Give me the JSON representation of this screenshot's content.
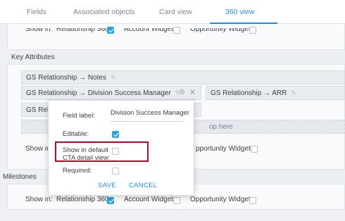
{
  "tabs": [
    {
      "label": "Fields"
    },
    {
      "label": "Associated objects"
    },
    {
      "label": "Card view"
    },
    {
      "label": "360 view",
      "active": true
    }
  ],
  "top_row": {
    "show_in": "Show in:",
    "relationship_label": "Relationship 360",
    "account_widget": "Account Widget",
    "opportunity_widget": "Opportunity Widget"
  },
  "key_attributes": {
    "title": "Key Attributes",
    "chips": {
      "notes": "GS Relationship → Notes",
      "dsm": "GS Relationship → Division Success Manager",
      "arr": "GS Relationship → ARR",
      "partial": "GS Relatio"
    },
    "drop_text": "op here",
    "show_in": "Show in:",
    "opportunity_widget": "pportunity Widget"
  },
  "milestones": {
    "title": "Milestones",
    "show_in": "Show in:",
    "relationship_label": "Relationship 360",
    "account_widget": "Account Widget",
    "opportunity_widget": "Opportunity Widget"
  },
  "popup": {
    "field_label_label": "Field label:",
    "field_label_value": "Division Success Manager",
    "editable_label": "Editable:",
    "editable_checked": true,
    "show_in_default_line1": "Show in default",
    "show_in_default_line2": "CTA detail view:",
    "show_in_default_checked": false,
    "required_label": "Required:",
    "required_checked": false,
    "save": "SAVE",
    "cancel": "CANCEL"
  },
  "colors": {
    "accent": "#1a8fe3",
    "highlight": "#d0021b",
    "checkbox_on": "#2aa5e0"
  }
}
